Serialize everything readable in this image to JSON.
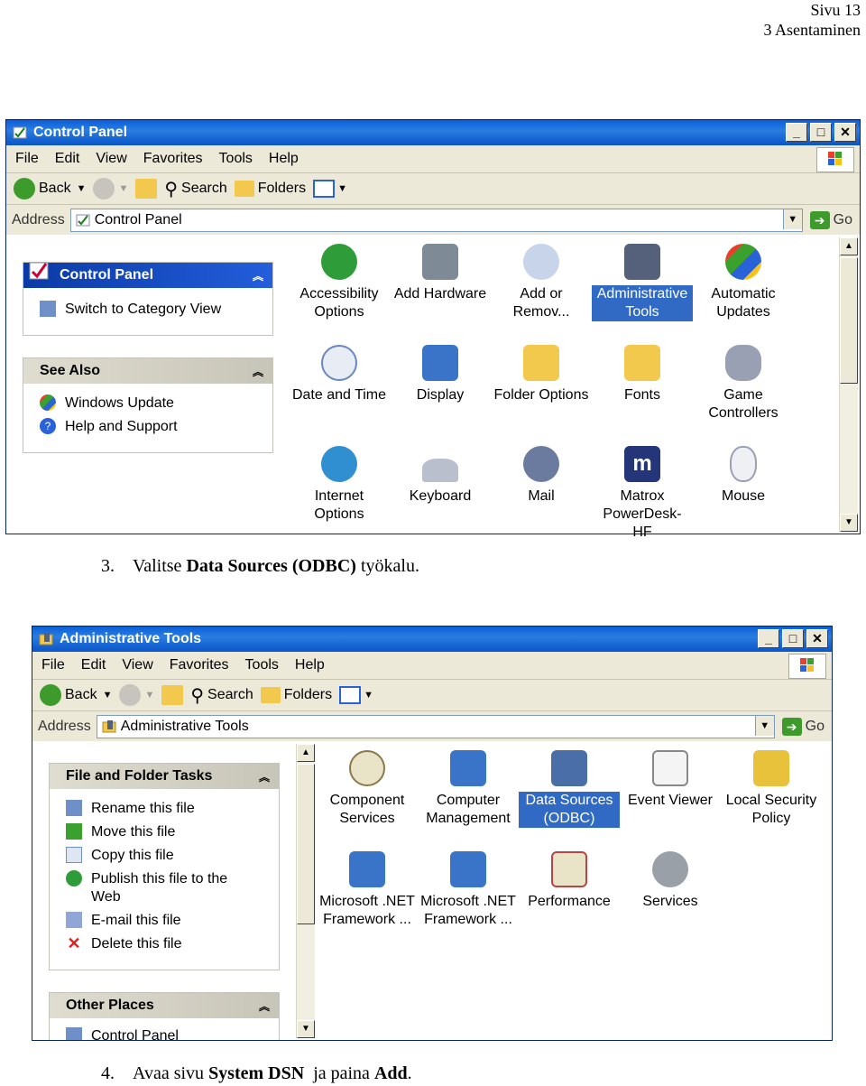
{
  "page_header": {
    "page": "Sivu 13",
    "section": "3 Asentaminen"
  },
  "captions": {
    "step3_prefix": "3.",
    "step3_text1": "Valitse ",
    "step3_bold": "Data Sources (ODBC)",
    "step3_text2": " työkalu.",
    "step4_prefix": "4.",
    "step4_text1": "Avaa sivu ",
    "step4_bold1": "System DSN",
    "step4_text2": "  ja paina ",
    "step4_bold2": "Add",
    "step4_text3": "."
  },
  "menu": {
    "file": "File",
    "edit": "Edit",
    "view": "View",
    "favorites": "Favorites",
    "tools": "Tools",
    "help": "Help"
  },
  "toolbar": {
    "back": "Back",
    "search": "Search",
    "folders": "Folders"
  },
  "address": {
    "label": "Address",
    "go": "Go"
  },
  "win1": {
    "title": "Control Panel",
    "address_value": "Control Panel",
    "side_panel": {
      "title": "Control Panel",
      "switch_label": "Switch to Category View"
    },
    "see_also": {
      "title": "See Also",
      "items": [
        "Windows Update",
        "Help and Support"
      ]
    },
    "icons": [
      {
        "label": "Accessibility Options",
        "icon": "accessibility-icon"
      },
      {
        "label": "Add Hardware",
        "icon": "add-hardware-icon"
      },
      {
        "label": "Add or Remov...",
        "icon": "add-remove-programs-icon"
      },
      {
        "label": "Administrative Tools",
        "icon": "administrative-tools-icon",
        "selected": true
      },
      {
        "label": "Automatic Updates",
        "icon": "automatic-updates-icon"
      },
      {
        "label": "Date and Time",
        "icon": "date-time-icon"
      },
      {
        "label": "Display",
        "icon": "display-icon"
      },
      {
        "label": "Folder Options",
        "icon": "folder-options-icon"
      },
      {
        "label": "Fonts",
        "icon": "fonts-icon"
      },
      {
        "label": "Game Controllers",
        "icon": "game-controllers-icon"
      },
      {
        "label": "Internet Options",
        "icon": "internet-options-icon"
      },
      {
        "label": "Keyboard",
        "icon": "keyboard-icon"
      },
      {
        "label": "Mail",
        "icon": "mail-icon"
      },
      {
        "label": "Matrox PowerDesk-HF",
        "icon": "matrox-icon"
      },
      {
        "label": "Mouse",
        "icon": "mouse-icon"
      }
    ]
  },
  "win2": {
    "title": "Administrative Tools",
    "address_value": "Administrative Tools",
    "file_tasks": {
      "title": "File and Folder Tasks",
      "items": [
        "Rename this file",
        "Move this file",
        "Copy this file",
        "Publish this file to the Web",
        "E-mail this file",
        "Delete this file"
      ]
    },
    "other_places": {
      "title": "Other Places",
      "items": [
        "Control Panel"
      ]
    },
    "icons": [
      {
        "label": "Component Services",
        "icon": "component-services-icon"
      },
      {
        "label": "Computer Management",
        "icon": "computer-management-icon"
      },
      {
        "label": "Data Sources (ODBC)",
        "icon": "data-sources-icon",
        "selected": true
      },
      {
        "label": "Event Viewer",
        "icon": "event-viewer-icon"
      },
      {
        "label": "Local Security Policy",
        "icon": "local-security-policy-icon"
      },
      {
        "label": "Microsoft .NET Framework ...",
        "icon": "dotnet-config-icon"
      },
      {
        "label": "Microsoft .NET Framework ...",
        "icon": "dotnet-wizards-icon"
      },
      {
        "label": "Performance",
        "icon": "performance-icon"
      },
      {
        "label": "Services",
        "icon": "services-icon"
      }
    ]
  },
  "colors": {
    "selection": "#316ac5",
    "titlebar": "#0a5fd8",
    "panel_head": "#245edb"
  }
}
